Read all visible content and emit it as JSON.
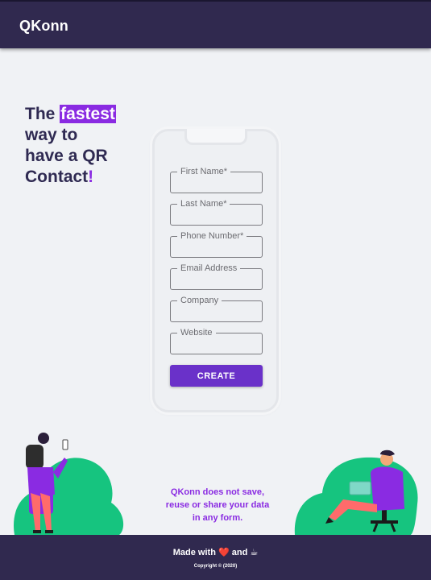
{
  "header": {
    "brand": "QKonn"
  },
  "hero": {
    "line1_pre": "The ",
    "highlight": "fastest",
    "line2": "way to",
    "line3": "have a QR",
    "line4": "Contact",
    "bang": "!"
  },
  "form": {
    "fields": [
      {
        "label": "First Name",
        "required": "*",
        "value": ""
      },
      {
        "label": "Last Name",
        "required": "*",
        "value": ""
      },
      {
        "label": "Phone Number",
        "required": "*",
        "value": ""
      },
      {
        "label": "Email Address",
        "required": "",
        "value": ""
      },
      {
        "label": "Company",
        "required": "",
        "value": ""
      },
      {
        "label": "Website",
        "required": "",
        "value": ""
      }
    ],
    "submit_label": "CREATE"
  },
  "privacy": {
    "text": "QKonn does not save, reuse or share your data in any form."
  },
  "footer": {
    "made_with_pre": "Made with",
    "heart_icon": "❤️",
    "and": "and",
    "coffee_icon": "☕",
    "copyright": "Copyright © (2020)"
  },
  "colors": {
    "nav": "#30294f",
    "accent": "#8a2be2",
    "button": "#6a31c9",
    "background": "#f0f2f5",
    "plant": "#16c47f"
  },
  "icons": {
    "left_illustration": "person-with-phone-illustration",
    "right_illustration": "person-with-laptop-illustration"
  }
}
